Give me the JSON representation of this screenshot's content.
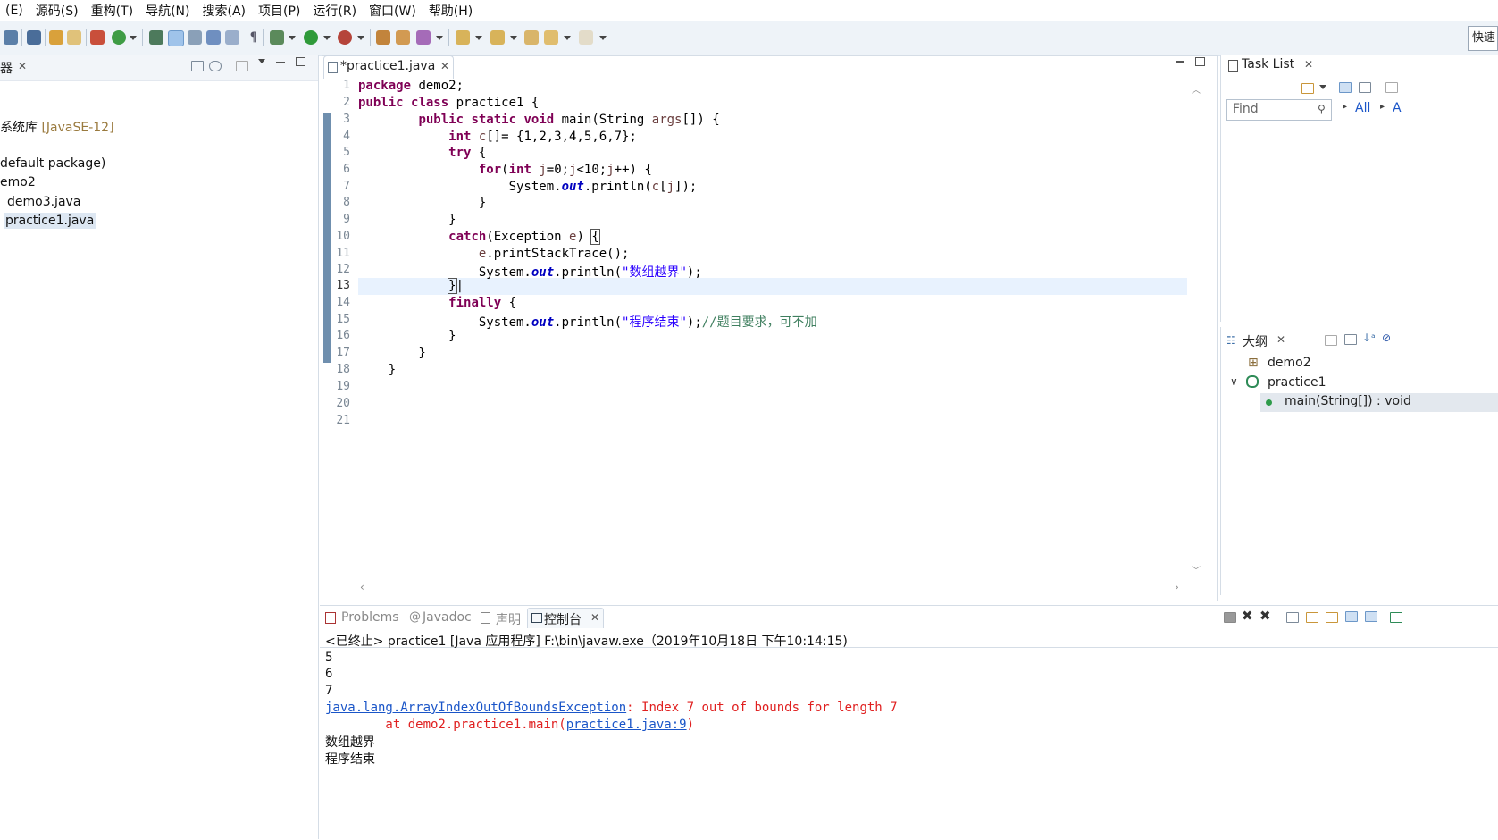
{
  "menu": [
    "(E)",
    "源码(S)",
    "重构(T)",
    "导航(N)",
    "搜索(A)",
    "项目(P)",
    "运行(R)",
    "窗口(W)",
    "帮助(H)"
  ],
  "quick_access": "快速",
  "package_explorer": {
    "tab_label": "器",
    "items": [
      {
        "label": "系统库",
        "suffix": "[JavaSE-12]"
      },
      {
        "label": "default package)"
      },
      {
        "label": "emo2"
      },
      {
        "label": "demo3.java"
      },
      {
        "label": "practice1.java",
        "selected": true
      }
    ]
  },
  "editor": {
    "tab_label": "*practice1.java",
    "line_numbers": [
      "1",
      "2",
      "3",
      "4",
      "5",
      "6",
      "7",
      "8",
      "9",
      "10",
      "11",
      "12",
      "13",
      "14",
      "15",
      "16",
      "17",
      "18",
      "19",
      "20",
      "21"
    ],
    "current_line": 13
  },
  "task_list": {
    "tab_label": "Task List",
    "find_placeholder": "Find",
    "filter_all": "All",
    "filter_a": "A"
  },
  "outline": {
    "tab_label": "大纲",
    "items": [
      "demo2",
      "practice1",
      "main(String[]) : void"
    ]
  },
  "console": {
    "tabs": [
      "Problems",
      "Javadoc",
      "声明",
      "控制台"
    ],
    "header": "<已终止> practice1 [Java 应用程序] F:\\bin\\javaw.exe（2019年10月18日 下午10:14:15)",
    "lines": [
      "5",
      "6",
      "7"
    ],
    "exception_class": "java.lang.ArrayIndexOutOfBoundsException",
    "exception_msg": ": Index 7 out of bounds for length 7",
    "at_prefix": "        at demo2.practice1.main(",
    "at_link": "practice1.java:9",
    "at_suffix": ")",
    "out1": "数组越界",
    "out2": "程序结束"
  }
}
